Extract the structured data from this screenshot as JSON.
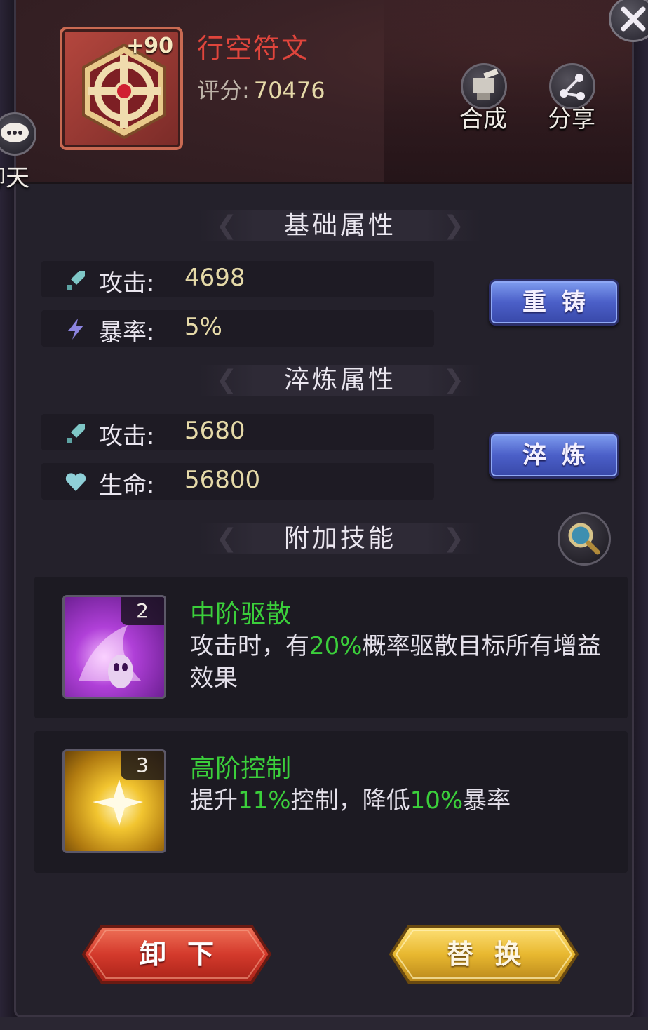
{
  "item": {
    "name": "行空符文",
    "level": "+90",
    "score_label": "评分:",
    "score_value": "70476"
  },
  "header_buttons": {
    "combine": "合成",
    "share": "分享"
  },
  "side": {
    "chat": "聊天"
  },
  "base_section": {
    "title": "基础属性",
    "stats": [
      {
        "label": "攻击:",
        "value": "4698",
        "icon": "attack-icon"
      },
      {
        "label": "暴率:",
        "value": "5%",
        "icon": "crit-icon"
      }
    ],
    "button": "重铸"
  },
  "refine_section": {
    "title": "淬炼属性",
    "stats": [
      {
        "label": "攻击:",
        "value": "5680",
        "icon": "attack-icon"
      },
      {
        "label": "生命:",
        "value": "56800",
        "icon": "heart-icon"
      }
    ],
    "button": "淬炼"
  },
  "skill_section": {
    "title": "附加技能",
    "skills": [
      {
        "name": "中阶驱散",
        "level": "2",
        "desc_parts": [
          "攻击时，有",
          "20%",
          "概率驱散目标所有增益效果"
        ]
      },
      {
        "name": "高阶控制",
        "level": "3",
        "desc_parts": [
          "提升",
          "11%",
          "控制，降低",
          "10%",
          "暴率"
        ]
      }
    ]
  },
  "actions": {
    "unload": "卸下",
    "replace": "替换"
  },
  "colors": {
    "item_name": "#e0453c",
    "highlight_green": "#3bcf3b",
    "value_gold": "#e5d9a8",
    "blue_button": "#4b5fc8"
  }
}
